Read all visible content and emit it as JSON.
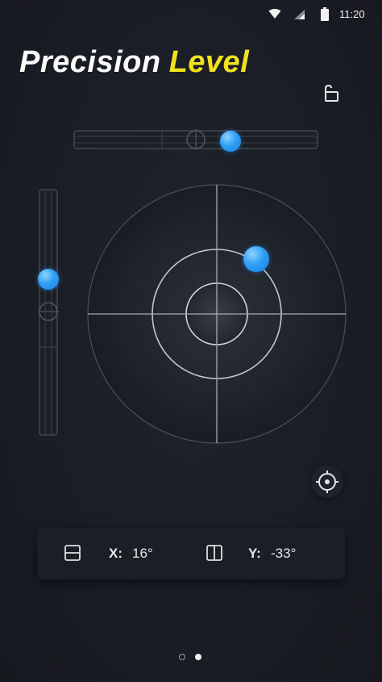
{
  "status_bar": {
    "time": "11:20"
  },
  "header": {
    "title_word1": "Precision",
    "title_word2": "Level"
  },
  "readout": {
    "x_label": "X:",
    "x_value": "16°",
    "y_label": "Y:",
    "y_value": "-33°"
  },
  "pager": {
    "pages": 2,
    "active_index": 1
  },
  "colors": {
    "accent_yellow": "#f3e11b",
    "bubble_blue": "#2f9ff5",
    "background": "#1a1d24"
  }
}
